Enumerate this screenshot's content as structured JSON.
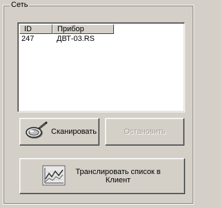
{
  "group": {
    "title": "Сеть"
  },
  "list": {
    "columns": [
      "ID",
      "Прибор"
    ],
    "rows": [
      {
        "id": "247",
        "device": "ДВТ-03.RS"
      }
    ]
  },
  "buttons": {
    "scan_label": "Сканировать",
    "scan_icon": "magnifier-icon",
    "stop_label": "Остановить",
    "stop_enabled": false,
    "translate_label": "Транслировать список в Клиент",
    "translate_icon": "chart-icon"
  }
}
